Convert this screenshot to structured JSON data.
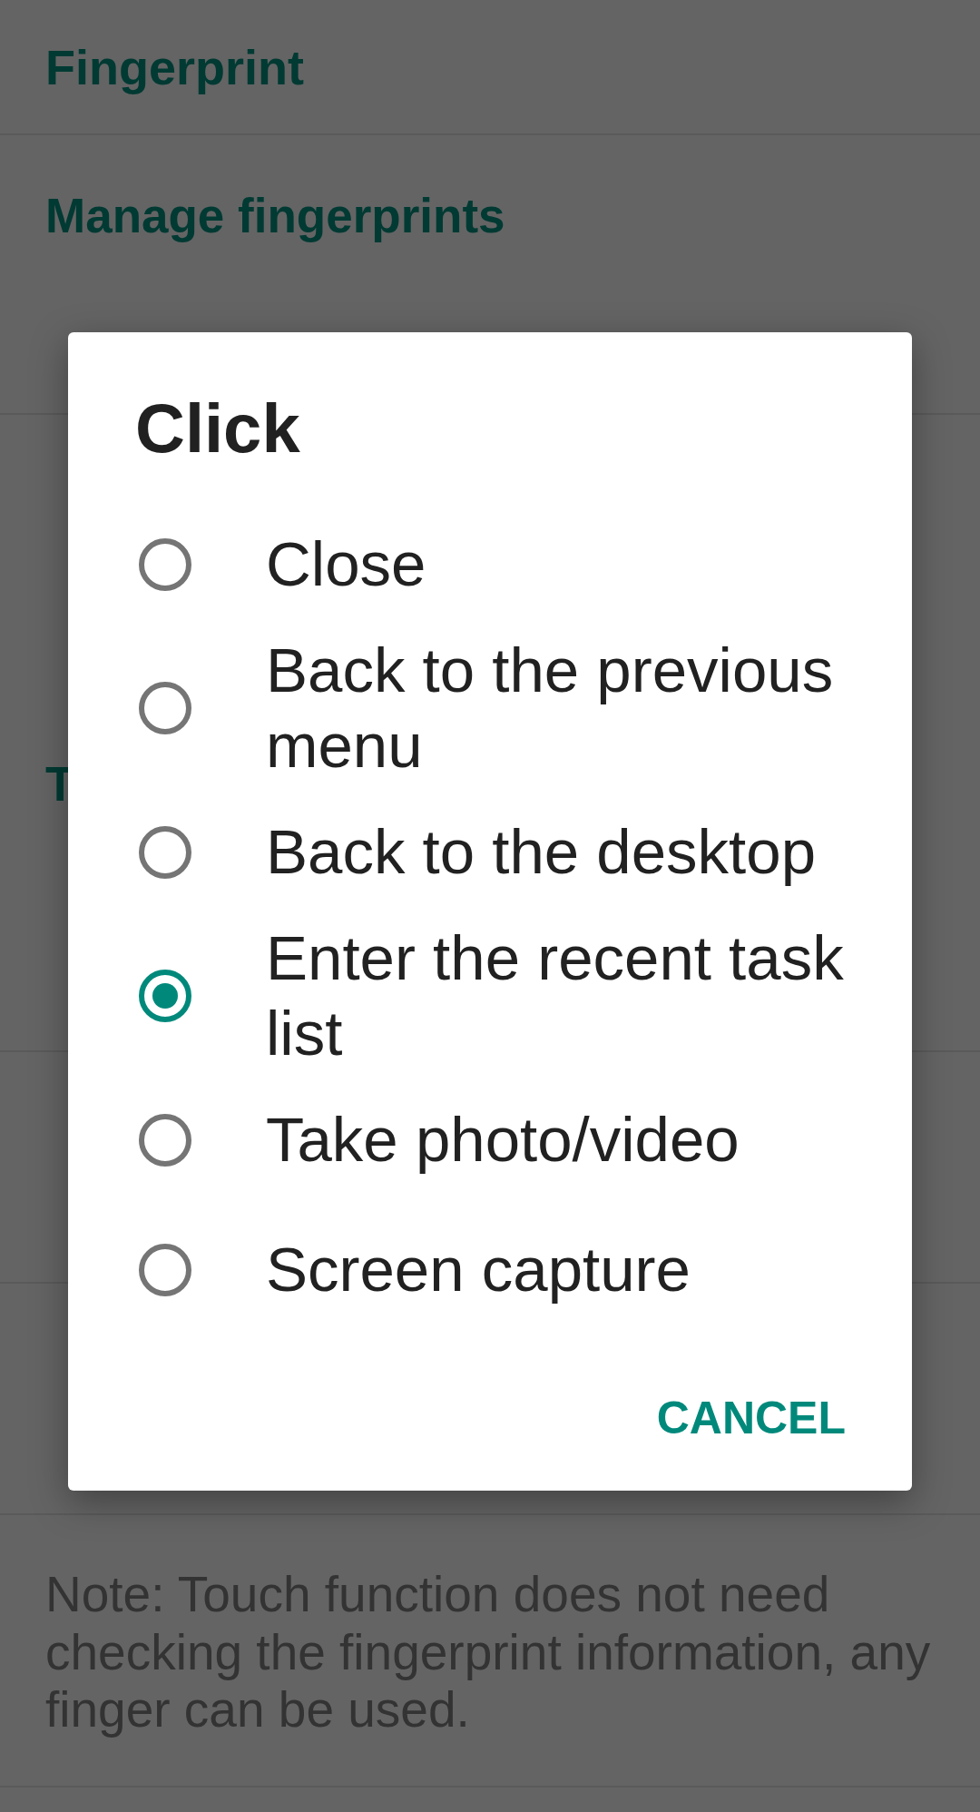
{
  "settings": {
    "title": "Fingerprint",
    "rows": [
      {
        "kind": "category",
        "title": "Manage fingerprints"
      },
      {
        "kind": "single"
      },
      {
        "kind": "triple"
      },
      {
        "kind": "category",
        "title": "T"
      },
      {
        "kind": "double"
      },
      {
        "kind": "double"
      },
      {
        "kind": "double"
      },
      {
        "kind": "note",
        "text": "Note: Touch function does not need checking the fingerprint information, any finger can be used."
      }
    ]
  },
  "dialog": {
    "title": "Click",
    "options": [
      {
        "label": "Close",
        "selected": false
      },
      {
        "label": "Back to the previous menu",
        "selected": false
      },
      {
        "label": "Back to the desktop",
        "selected": false
      },
      {
        "label": "Enter the recent task list",
        "selected": true
      },
      {
        "label": "Take photo/video",
        "selected": false
      },
      {
        "label": "Screen capture",
        "selected": false
      }
    ],
    "buttons": [
      "CANCEL"
    ]
  }
}
